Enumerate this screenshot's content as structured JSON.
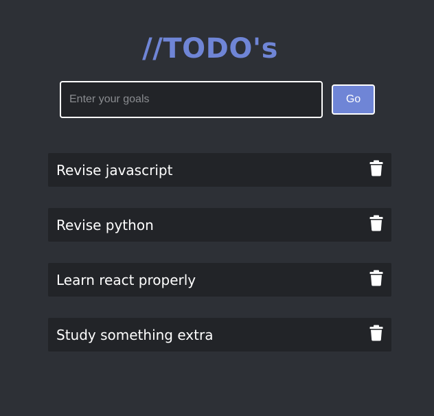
{
  "header": {
    "title": "//TODO's"
  },
  "form": {
    "input_placeholder": "Enter your goals",
    "input_value": "",
    "go_label": "Go"
  },
  "todos": [
    {
      "text": "Revise javascript",
      "icon": "trash-icon"
    },
    {
      "text": "Revise python",
      "icon": "trash-icon"
    },
    {
      "text": "Learn react properly",
      "icon": "trash-icon"
    },
    {
      "text": "Study something extra",
      "icon": "trash-icon"
    }
  ],
  "colors": {
    "background": "#2d3036",
    "accent": "#6f85d6",
    "item_background": "#222428",
    "text": "#ffffff"
  }
}
